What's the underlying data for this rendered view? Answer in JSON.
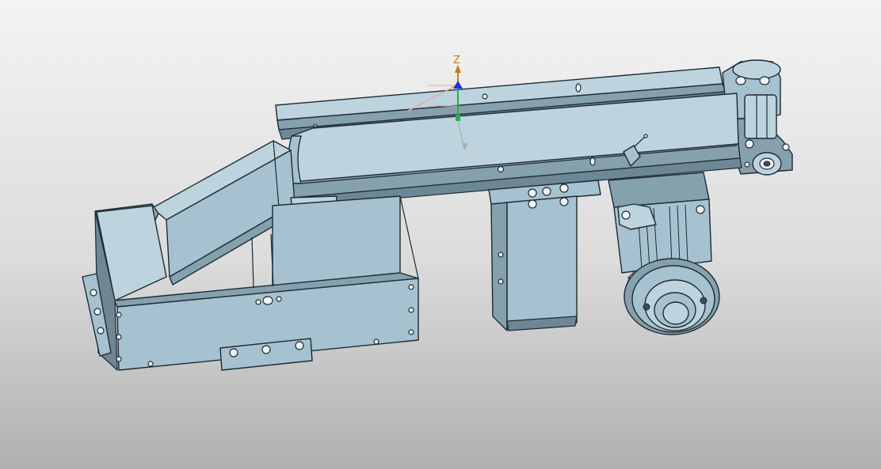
{
  "view": {
    "background_top": "#f4f4f4",
    "background_bottom": "#b0b0b0",
    "model_color": "#a6c2d0",
    "edge_color": "#1d2b33"
  },
  "triad": {
    "z_label": "Z",
    "z_color": "#c77a14",
    "x_color": "#e8a898",
    "y_color": "#22b14c",
    "origin_color": "#1f2fd6"
  }
}
